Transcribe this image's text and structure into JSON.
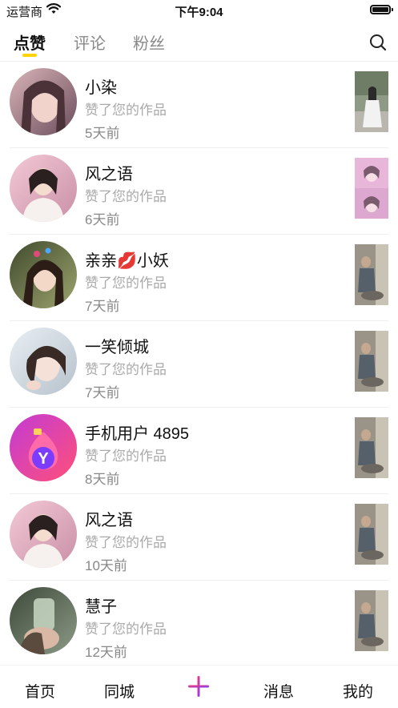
{
  "status_bar": {
    "carrier": "运营商",
    "time": "下午9:04"
  },
  "tabs": [
    {
      "label": "点赞",
      "active": true
    },
    {
      "label": "评论",
      "active": false
    },
    {
      "label": "粉丝",
      "active": false
    }
  ],
  "colors": {
    "accent": "#ffd400",
    "plus_gradient": [
      "#ff3b6b",
      "#7a3cff"
    ]
  },
  "notifications": [
    {
      "name": "小染",
      "action": "赞了您的作品",
      "ago": "5天前"
    },
    {
      "name": "风之语",
      "action": "赞了您的作品",
      "ago": "6天前"
    },
    {
      "name": "亲亲💋小妖",
      "action": "赞了您的作品",
      "ago": "7天前"
    },
    {
      "name": "一笑倾城",
      "action": "赞了您的作品",
      "ago": "7天前"
    },
    {
      "name": "手机用户 4895",
      "action": "赞了您的作品",
      "ago": "8天前"
    },
    {
      "name": "风之语",
      "action": "赞了您的作品",
      "ago": "10天前"
    },
    {
      "name": "慧子",
      "action": "赞了您的作品",
      "ago": "12天前"
    }
  ],
  "bottom_nav": {
    "home": "首页",
    "nearby": "同城",
    "messages": "消息",
    "mine": "我的"
  }
}
